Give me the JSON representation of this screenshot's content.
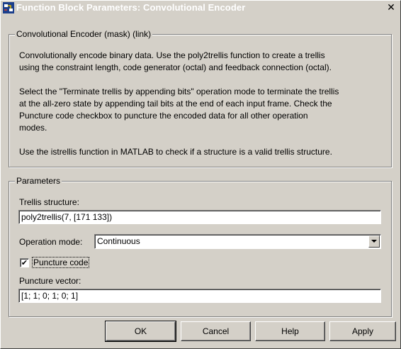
{
  "window": {
    "title": "Function Block Parameters: Convolutional Encoder",
    "close_glyph": "✕"
  },
  "mask_group": {
    "legend": "Convolutional Encoder (mask) (link)",
    "paragraphs": [
      [
        "Convolutionally encode binary data.  Use the poly2trellis function to create a trellis",
        "using the constraint length, code generator (octal) and feedback connection (octal)."
      ],
      [
        "Select the \"Terminate trellis by appending bits\" operation mode to terminate the trellis",
        "at the all-zero state by appending tail bits at the end of each input frame.  Check the",
        "Puncture code checkbox to puncture the encoded data for all other operation",
        "modes."
      ],
      [
        "Use the istrellis function in MATLAB to check if a structure is a valid trellis structure."
      ]
    ]
  },
  "parameters": {
    "legend": "Parameters",
    "trellis_label": "Trellis structure:",
    "trellis_value": "poly2trellis(7, [171 133])",
    "operation_mode_label": "Operation mode:",
    "operation_mode_value": "Continuous",
    "puncture_checked": true,
    "puncture_label": "Puncture code",
    "puncture_vector_label": "Puncture vector:",
    "puncture_vector_value": "[1; 1; 0; 1; 0; 1]"
  },
  "buttons": {
    "ok": "OK",
    "cancel": "Cancel",
    "help": "Help",
    "apply": "Apply"
  },
  "colors": {
    "face": "#d4d0c8",
    "field": "#ffffff"
  },
  "icons": {
    "app": "simulink-block-icon",
    "close": "close-icon",
    "dropdown": "chevron-down-icon",
    "check": "checkmark-icon"
  }
}
